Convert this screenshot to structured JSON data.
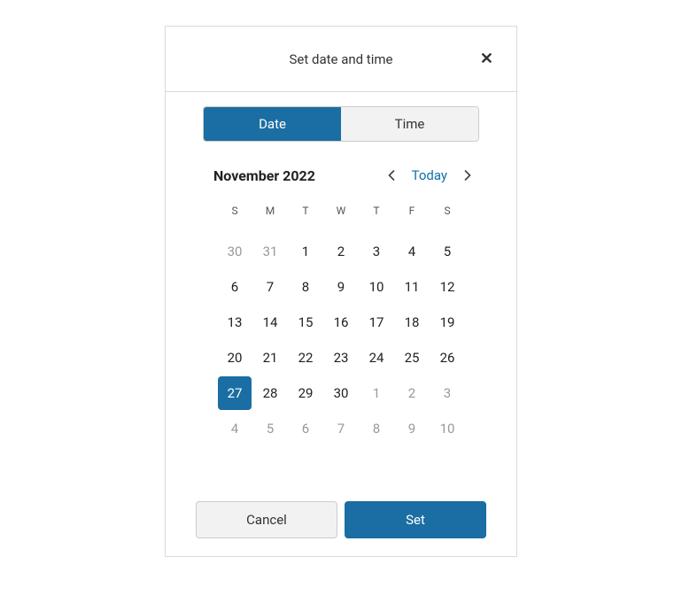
{
  "header": {
    "title": "Set date and time"
  },
  "tabs": {
    "date_label": "Date",
    "time_label": "Time"
  },
  "calendar": {
    "month_label": "November 2022",
    "today_label": "Today",
    "dow": [
      "S",
      "M",
      "T",
      "W",
      "T",
      "F",
      "S"
    ],
    "cells": [
      {
        "n": 30,
        "out": true,
        "selected": false
      },
      {
        "n": 31,
        "out": true,
        "selected": false
      },
      {
        "n": 1,
        "out": false,
        "selected": false
      },
      {
        "n": 2,
        "out": false,
        "selected": false
      },
      {
        "n": 3,
        "out": false,
        "selected": false
      },
      {
        "n": 4,
        "out": false,
        "selected": false
      },
      {
        "n": 5,
        "out": false,
        "selected": false
      },
      {
        "n": 6,
        "out": false,
        "selected": false
      },
      {
        "n": 7,
        "out": false,
        "selected": false
      },
      {
        "n": 8,
        "out": false,
        "selected": false
      },
      {
        "n": 9,
        "out": false,
        "selected": false
      },
      {
        "n": 10,
        "out": false,
        "selected": false
      },
      {
        "n": 11,
        "out": false,
        "selected": false
      },
      {
        "n": 12,
        "out": false,
        "selected": false
      },
      {
        "n": 13,
        "out": false,
        "selected": false
      },
      {
        "n": 14,
        "out": false,
        "selected": false
      },
      {
        "n": 15,
        "out": false,
        "selected": false
      },
      {
        "n": 16,
        "out": false,
        "selected": false
      },
      {
        "n": 17,
        "out": false,
        "selected": false
      },
      {
        "n": 18,
        "out": false,
        "selected": false
      },
      {
        "n": 19,
        "out": false,
        "selected": false
      },
      {
        "n": 20,
        "out": false,
        "selected": false
      },
      {
        "n": 21,
        "out": false,
        "selected": false
      },
      {
        "n": 22,
        "out": false,
        "selected": false
      },
      {
        "n": 23,
        "out": false,
        "selected": false
      },
      {
        "n": 24,
        "out": false,
        "selected": false
      },
      {
        "n": 25,
        "out": false,
        "selected": false
      },
      {
        "n": 26,
        "out": false,
        "selected": false
      },
      {
        "n": 27,
        "out": false,
        "selected": true
      },
      {
        "n": 28,
        "out": false,
        "selected": false
      },
      {
        "n": 29,
        "out": false,
        "selected": false
      },
      {
        "n": 30,
        "out": false,
        "selected": false
      },
      {
        "n": 1,
        "out": true,
        "selected": false
      },
      {
        "n": 2,
        "out": true,
        "selected": false
      },
      {
        "n": 3,
        "out": true,
        "selected": false
      },
      {
        "n": 4,
        "out": true,
        "selected": false
      },
      {
        "n": 5,
        "out": true,
        "selected": false
      },
      {
        "n": 6,
        "out": true,
        "selected": false
      },
      {
        "n": 7,
        "out": true,
        "selected": false
      },
      {
        "n": 8,
        "out": true,
        "selected": false
      },
      {
        "n": 9,
        "out": true,
        "selected": false
      },
      {
        "n": 10,
        "out": true,
        "selected": false
      }
    ]
  },
  "footer": {
    "cancel_label": "Cancel",
    "set_label": "Set"
  }
}
